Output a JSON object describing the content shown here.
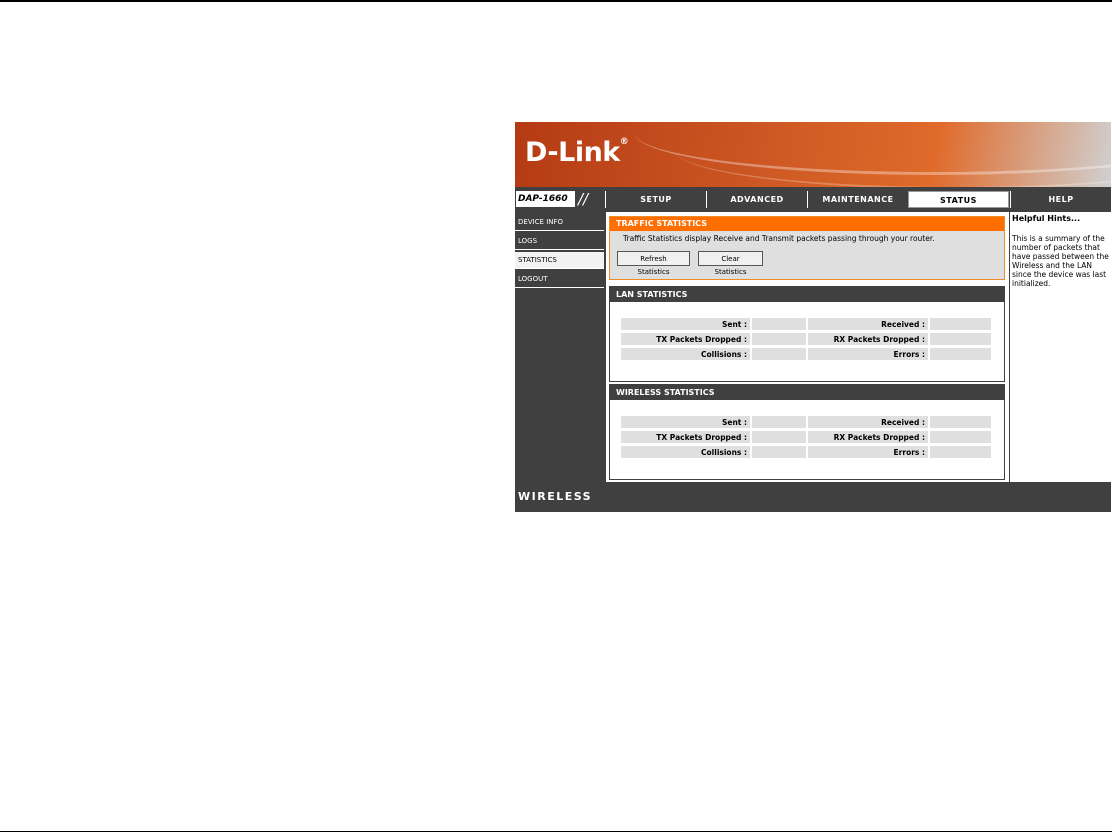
{
  "brand": {
    "logo": "D-Link",
    "registered": "®",
    "model": "DAP-1660",
    "footer": "WIRELESS"
  },
  "tabs": [
    {
      "label": "SETUP"
    },
    {
      "label": "ADVANCED"
    },
    {
      "label": "MAINTENANCE"
    },
    {
      "label": "STATUS",
      "active": true
    },
    {
      "label": "HELP"
    }
  ],
  "sidebar": {
    "items": [
      {
        "label": "DEVICE INFO"
      },
      {
        "label": "LOGS"
      },
      {
        "label": "STATISTICS",
        "active": true
      },
      {
        "label": "LOGOUT"
      }
    ]
  },
  "traffic": {
    "title": "TRAFFIC STATISTICS",
    "description": "Traffic Statistics display Receive and Transmit packets passing through your router.",
    "refresh_label": "Refresh Statistics",
    "clear_label": "Clear Statistics"
  },
  "lan": {
    "title": "LAN STATISTICS",
    "rows": [
      {
        "left_label": "Sent :",
        "left_value": "",
        "right_label": "Received :",
        "right_value": ""
      },
      {
        "left_label": "TX Packets Dropped :",
        "left_value": "",
        "right_label": "RX Packets Dropped :",
        "right_value": ""
      },
      {
        "left_label": "Collisions :",
        "left_value": "",
        "right_label": "Errors :",
        "right_value": ""
      }
    ]
  },
  "wireless": {
    "title": "WIRELESS STATISTICS",
    "rows": [
      {
        "left_label": "Sent :",
        "left_value": "",
        "right_label": "Received :",
        "right_value": ""
      },
      {
        "left_label": "TX Packets Dropped :",
        "left_value": "",
        "right_label": "RX Packets Dropped :",
        "right_value": ""
      },
      {
        "left_label": "Collisions :",
        "left_value": "",
        "right_label": "Errors :",
        "right_value": ""
      }
    ]
  },
  "hints": {
    "title": "Helpful Hints...",
    "text": "This is a summary of the number of packets that have passed between the Wireless and the LAN since the device was last initialized."
  },
  "colors": {
    "brand_orange": "#ff6f00",
    "panel_dark": "#404040",
    "cell_gray": "#dfdfdf"
  }
}
